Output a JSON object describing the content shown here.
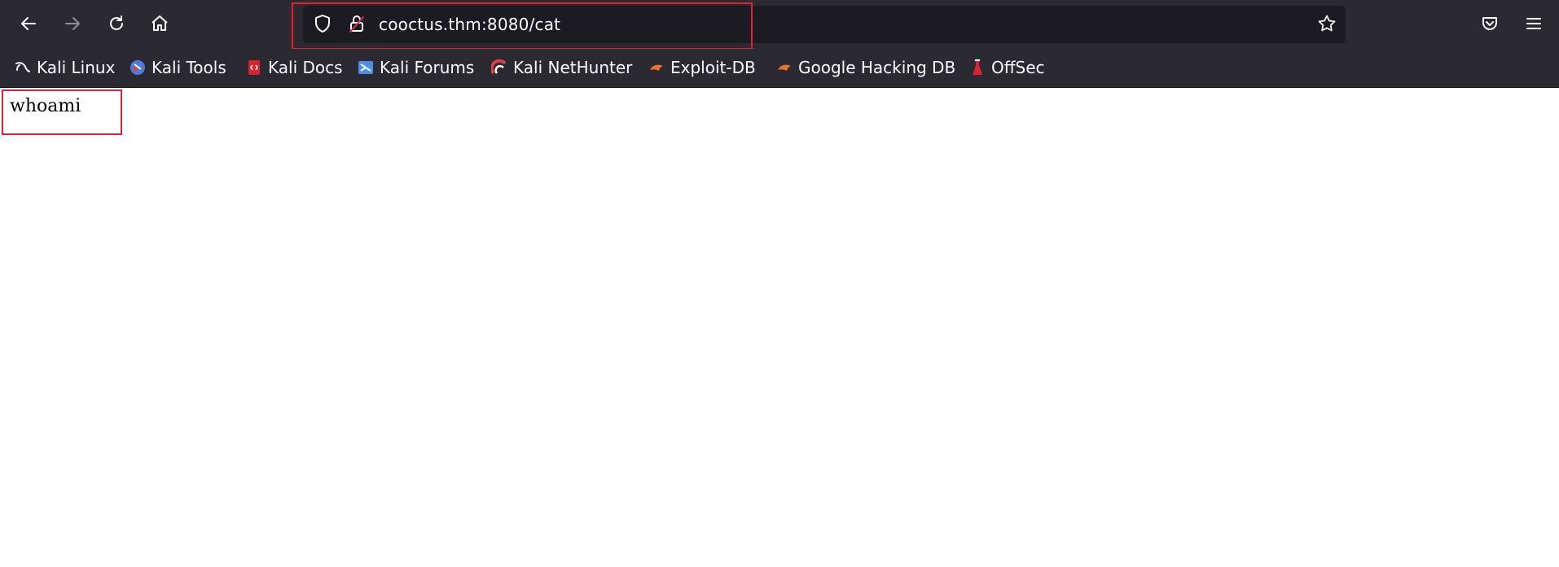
{
  "browser": {
    "url": "cooctus.thm:8080/cat",
    "nav_icons": [
      "back-arrow-icon",
      "forward-arrow-icon",
      "reload-icon",
      "home-icon"
    ],
    "url_icons": [
      "shield-icon",
      "insecure-lock-icon",
      "star-icon"
    ],
    "right_icons": [
      "pocket-icon",
      "hamburger-menu-icon"
    ]
  },
  "bookmarks": [
    {
      "label": "Kali Linux",
      "icon": "kali-dragon-icon"
    },
    {
      "label": "Kali Tools",
      "icon": "kali-tools-icon"
    },
    {
      "label": "Kali Docs",
      "icon": "kali-docs-icon"
    },
    {
      "label": "Kali Forums",
      "icon": "kali-forums-icon"
    },
    {
      "label": "Kali NetHunter",
      "icon": "kali-nethunter-icon"
    },
    {
      "label": "Exploit-DB",
      "icon": "exploit-db-icon"
    },
    {
      "label": "Google Hacking DB",
      "icon": "google-hacking-db-icon"
    },
    {
      "label": "OffSec",
      "icon": "offsec-icon"
    }
  ],
  "page": {
    "body_text": "whoami"
  },
  "colors": {
    "toolbar_bg": "#2b2a33",
    "urlbar_bg": "#1c1b22",
    "highlight": "#e0232e"
  }
}
